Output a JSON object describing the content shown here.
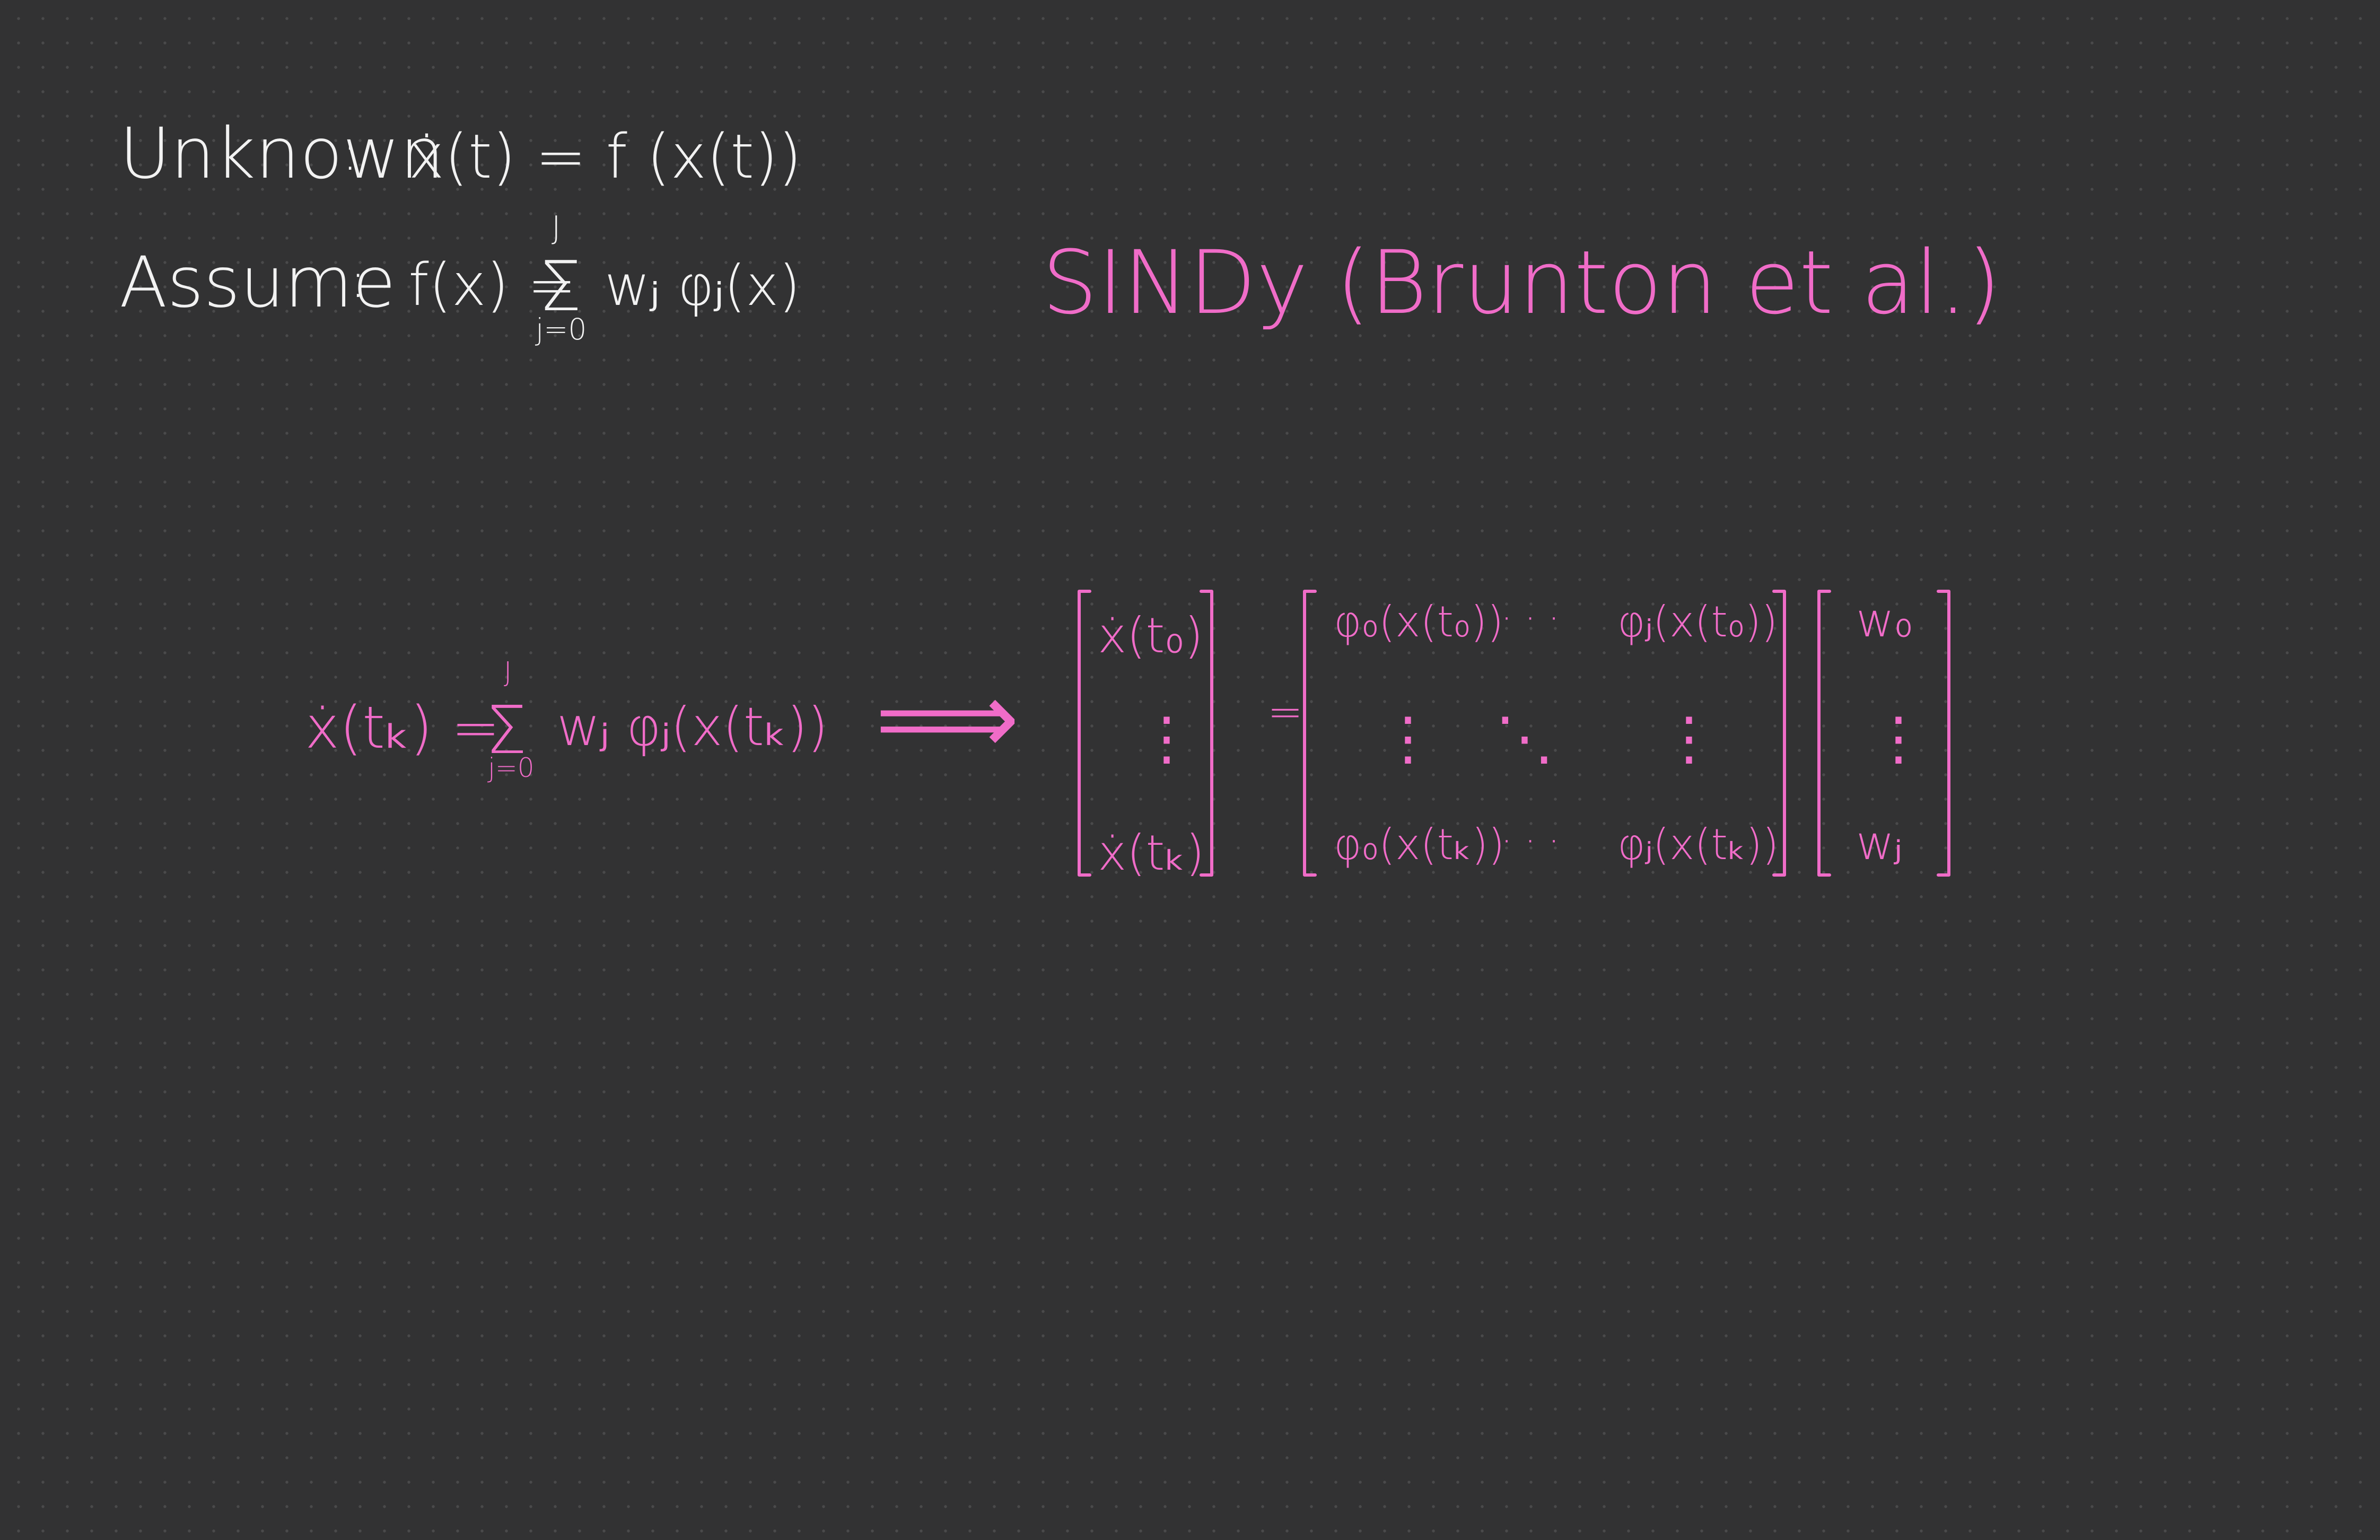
{
  "notes": {
    "unknown_label": "Unknown",
    "unknown_eq": "ẋ(t) = f (x(t))",
    "assume_label": "Assume",
    "assume_eq_lhs": "f(x) =",
    "assume_sum_top": "J",
    "assume_sum_bottom": "j=0",
    "assume_eq_rhs": "wⱼ φⱼ(x)",
    "title": "SINDy (Brunton et al.)"
  },
  "equation": {
    "lhs": "ẋ(tₖ) =",
    "sum_top": "J",
    "sum_bottom": "j=0",
    "rhs": "wⱼ φⱼ(x(tₖ))",
    "arrow": "⟹"
  },
  "matrix": {
    "lhs_vector": [
      "ẋ(t₀)",
      "⋮",
      "ẋ(tₖ)"
    ],
    "equals": "=",
    "phi": {
      "r0c0": "φ₀(x(t₀))",
      "r0c1": "· · ·",
      "r0c2": "φⱼ(x(t₀))",
      "r1c0": "⋮",
      "r1c1": "⋱",
      "r1c2": "⋮",
      "r2c0": "φ₀(x(tₖ))",
      "r2c1": "· · ·",
      "r2c2": "φⱼ(x(tₖ))"
    },
    "w_vector": [
      "w₀",
      "⋮",
      "wⱼ"
    ]
  },
  "colors": {
    "background": "#323233",
    "grid_dot": "#4a4a4b",
    "ink_white": "#f2f2f2",
    "ink_pink": "#f06cc8"
  }
}
